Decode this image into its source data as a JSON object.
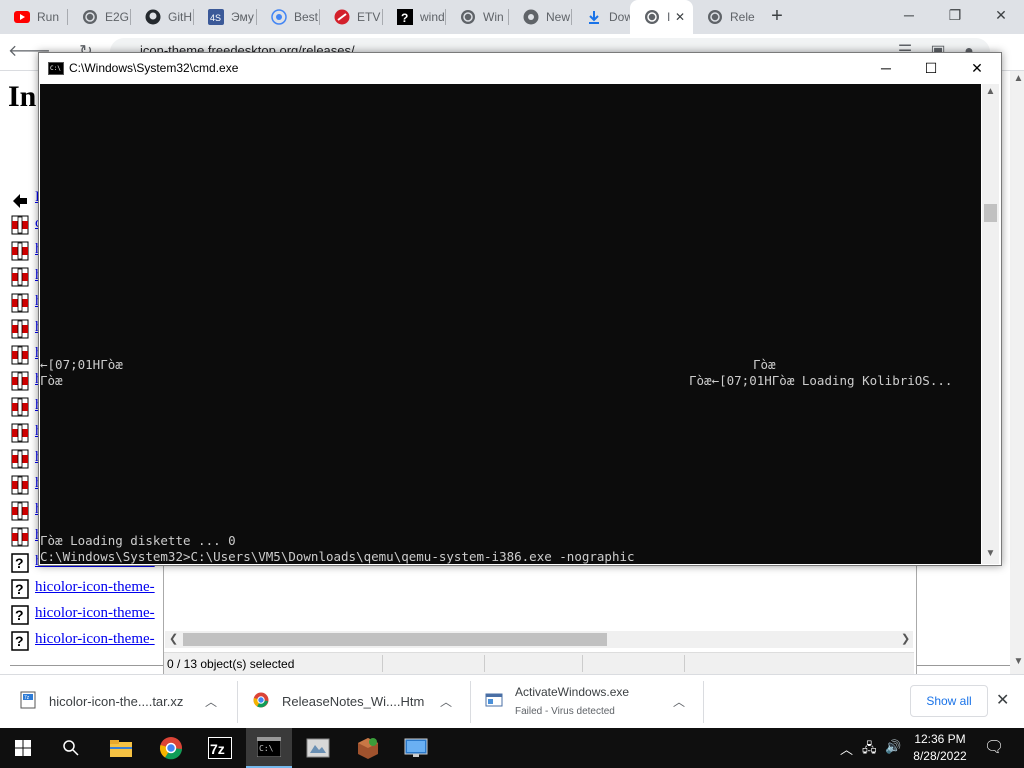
{
  "browser": {
    "tabs": [
      {
        "label": "Run",
        "icon": "youtube-icon"
      },
      {
        "label": "E2G",
        "icon": "globe-icon"
      },
      {
        "label": "GitH",
        "icon": "github-icon"
      },
      {
        "label": "Эму",
        "icon": "4s-icon"
      },
      {
        "label": "Best",
        "icon": "globe-icon"
      },
      {
        "label": "ETV",
        "icon": "opera-icon"
      },
      {
        "label": "wind",
        "icon": "question-icon"
      },
      {
        "label": "Win",
        "icon": "globe-icon"
      },
      {
        "label": "New",
        "icon": "chrome-icon"
      },
      {
        "label": "Dow",
        "icon": "download-icon"
      },
      {
        "label": "I",
        "icon": "globe-icon",
        "active": true
      },
      {
        "label": "Rele",
        "icon": "globe-icon"
      }
    ],
    "new_tab": "+",
    "url": "icon-theme.freedesktop.org/releases/",
    "window_buttons": {
      "minimize": "─",
      "restore": "❐",
      "close": "✕"
    }
  },
  "page": {
    "title": "In",
    "parent_link": "P",
    "rows": [
      {
        "icon": "parent-dir-icon",
        "text": "P"
      },
      {
        "icon": "archive-icon",
        "text": "c"
      },
      {
        "icon": "archive-icon",
        "text": "h"
      },
      {
        "icon": "archive-icon",
        "text": "h"
      },
      {
        "icon": "archive-icon",
        "text": "h"
      },
      {
        "icon": "archive-icon",
        "text": "h"
      },
      {
        "icon": "archive-icon",
        "text": "h"
      },
      {
        "icon": "archive-icon",
        "text": "h"
      },
      {
        "icon": "archive-icon",
        "text": "h"
      },
      {
        "icon": "archive-icon",
        "text": "h"
      },
      {
        "icon": "archive-icon",
        "text": "h"
      },
      {
        "icon": "archive-icon",
        "text": "h"
      },
      {
        "icon": "archive-icon",
        "text": "h"
      },
      {
        "icon": "archive-icon",
        "text": "h"
      },
      {
        "icon": "unknown-file-icon",
        "text": "hicolor-icon-theme-"
      },
      {
        "icon": "unknown-file-icon",
        "text": "hicolor-icon-theme-"
      },
      {
        "icon": "unknown-file-icon",
        "text": "hicolor-icon-theme-"
      },
      {
        "icon": "unknown-file-icon",
        "text": "hicolor-icon-theme-"
      }
    ]
  },
  "explorer": {
    "status": "0 / 13 object(s) selected"
  },
  "cmd": {
    "title": "C:\\Windows\\System32\\cmd.exe",
    "buttons": {
      "minimize": "─",
      "maximize": "☐",
      "close": "✕"
    },
    "lines": {
      "l1_left": "←[07;01HГòæ",
      "l1_right": "Гòæ",
      "l2_left": "Гòæ",
      "l2_right": "Гòæ←[07;01HГòæ Loading KolibriOS...",
      "l3": "Гòæ Loading diskette ... 0",
      "l4": "C:\\Windows\\System32>C:\\Users\\VM5\\Downloads\\qemu\\qemu-system-i386.exe -nographic"
    }
  },
  "downloads": {
    "items": [
      {
        "name": "hicolor-icon-the....tar.xz",
        "icon": "archive-file-icon"
      },
      {
        "name": "ReleaseNotes_Wi....Htm",
        "icon": "chrome-file-icon"
      },
      {
        "name": "ActivateWindows.exe",
        "status": "Failed - Virus detected",
        "icon": "exe-file-icon"
      }
    ],
    "show_all": "Show all",
    "close": "✕"
  },
  "taskbar": {
    "time": "12:36 PM",
    "date": "8/28/2022",
    "apps": [
      "file-explorer-icon",
      "chrome-icon",
      "7zip-icon",
      "cmd-icon",
      "app-icon",
      "package-icon",
      "monitor-icon"
    ]
  },
  "colors": {
    "link": "#0000ee",
    "console_bg": "#0c0c0c",
    "console_fg": "#cccccc",
    "taskbar_bg": "#0f0f0f",
    "accent": "#1a73e8"
  }
}
